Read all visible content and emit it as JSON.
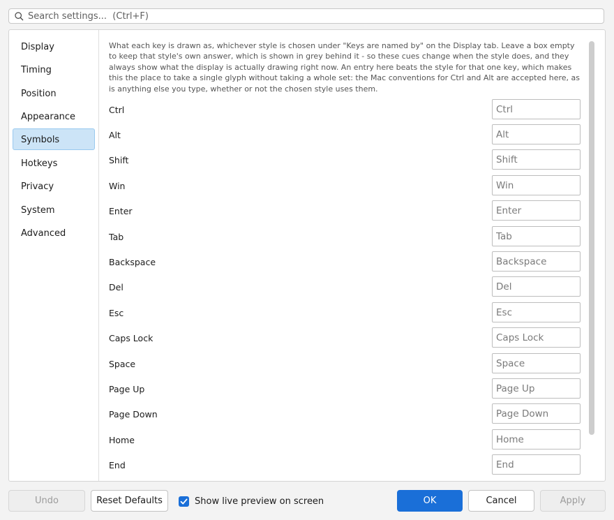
{
  "search": {
    "placeholder": "Search settings...  (Ctrl+F)"
  },
  "sidebar": {
    "items": [
      {
        "label": "Display"
      },
      {
        "label": "Timing"
      },
      {
        "label": "Position"
      },
      {
        "label": "Appearance"
      },
      {
        "label": "Symbols",
        "active": true
      },
      {
        "label": "Hotkeys"
      },
      {
        "label": "Privacy"
      },
      {
        "label": "System"
      },
      {
        "label": "Advanced"
      }
    ]
  },
  "content": {
    "description": "What each key is drawn as, whichever style is chosen under \"Keys are named by\" on the Display tab. Leave a box empty to keep that style's own answer, which is shown in grey behind it - so these cues change when the style does, and they always show what the display is actually drawing right now. An entry here beats the style for that one key, which makes this the place to take a single glyph without taking a whole set: the Mac conventions for Ctrl and Alt are accepted here, as is anything else you type, whether or not the chosen style uses them.",
    "rows": [
      {
        "label": "Ctrl",
        "placeholder": "Ctrl",
        "value": ""
      },
      {
        "label": "Alt",
        "placeholder": "Alt",
        "value": ""
      },
      {
        "label": "Shift",
        "placeholder": "Shift",
        "value": ""
      },
      {
        "label": "Win",
        "placeholder": "Win",
        "value": ""
      },
      {
        "label": "Enter",
        "placeholder": "Enter",
        "value": ""
      },
      {
        "label": "Tab",
        "placeholder": "Tab",
        "value": ""
      },
      {
        "label": "Backspace",
        "placeholder": "Backspace",
        "value": ""
      },
      {
        "label": "Del",
        "placeholder": "Del",
        "value": ""
      },
      {
        "label": "Esc",
        "placeholder": "Esc",
        "value": ""
      },
      {
        "label": "Caps Lock",
        "placeholder": "Caps Lock",
        "value": ""
      },
      {
        "label": "Space",
        "placeholder": "Space",
        "value": ""
      },
      {
        "label": "Page Up",
        "placeholder": "Page Up",
        "value": ""
      },
      {
        "label": "Page Down",
        "placeholder": "Page Down",
        "value": ""
      },
      {
        "label": "Home",
        "placeholder": "Home",
        "value": ""
      },
      {
        "label": "End",
        "placeholder": "End",
        "value": ""
      }
    ]
  },
  "footer": {
    "undo_label": "Undo",
    "reset_label": "Reset Defaults",
    "preview_label": "Show live preview on screen",
    "preview_checked": true,
    "ok_label": "OK",
    "cancel_label": "Cancel",
    "apply_label": "Apply"
  },
  "colors": {
    "accent": "#1a6fd8",
    "selected_nav_bg": "#cce4f7",
    "selected_nav_border": "#99c9ef"
  }
}
